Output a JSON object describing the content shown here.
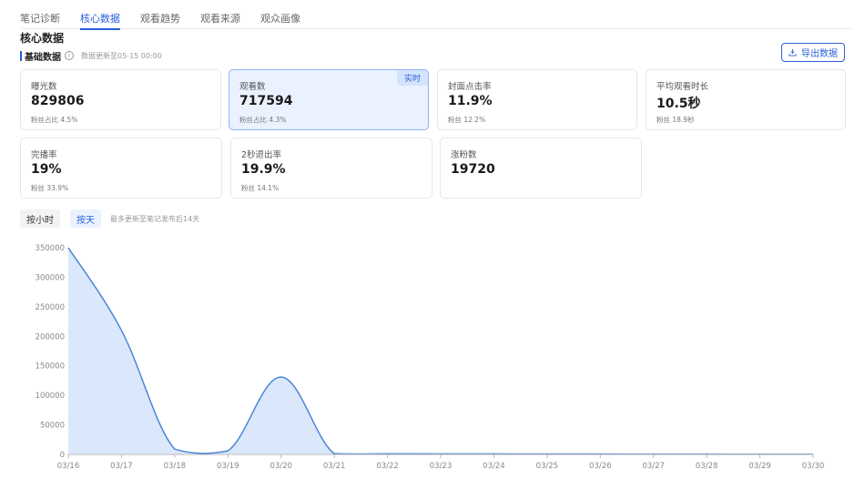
{
  "tabs": [
    {
      "label": "笔记诊断",
      "active": false
    },
    {
      "label": "核心数据",
      "active": true
    },
    {
      "label": "观看趋势",
      "active": false
    },
    {
      "label": "观看来源",
      "active": false
    },
    {
      "label": "观众画像",
      "active": false
    }
  ],
  "section_title": "核心数据",
  "basic": {
    "title": "基础数据",
    "info_icon": "i",
    "updated": "数据更新至05-15 00:00"
  },
  "export_label": "导出数据",
  "cards": [
    {
      "label": "曝光数",
      "value": "829806",
      "sub": "粉丝占比 4.5%",
      "badge": ""
    },
    {
      "label": "观看数",
      "value": "717594",
      "sub": "粉丝占比 4.3%",
      "badge": "实时"
    },
    {
      "label": "封面点击率",
      "value": "11.9%",
      "sub": "粉丝 12.2%",
      "badge": ""
    },
    {
      "label": "平均观看时长",
      "value": "10.5秒",
      "sub": "粉丝 18.9秒",
      "badge": ""
    },
    {
      "label": "完播率",
      "value": "19%",
      "sub": "粉丝 33.9%",
      "badge": ""
    },
    {
      "label": "2秒退出率",
      "value": "19.9%",
      "sub": "粉丝 14.1%",
      "badge": ""
    },
    {
      "label": "涨粉数",
      "value": "19720",
      "sub": "",
      "badge": ""
    }
  ],
  "toggles": {
    "hour": "按小时",
    "day": "按天",
    "selected": "day"
  },
  "toggle_note": "最多更新至笔记发布后14天",
  "colors": {
    "accent": "#2b5fd9",
    "line": "#4a86d6",
    "area": "#dbe8fb"
  },
  "chart_data": {
    "type": "area",
    "x": [
      "03/16",
      "03/17",
      "03/18",
      "03/19",
      "03/20",
      "03/21",
      "03/22",
      "03/23",
      "03/24",
      "03/25",
      "03/26",
      "03/27",
      "03/28",
      "03/29",
      "03/30"
    ],
    "values": [
      350000,
      210000,
      9000,
      6000,
      131000,
      1500,
      1200,
      1000,
      900,
      800,
      700,
      600,
      500,
      400,
      300
    ],
    "yticks": [
      0,
      50000,
      100000,
      150000,
      200000,
      250000,
      300000,
      350000
    ],
    "ylim": [
      0,
      350000
    ],
    "grid": false,
    "smooth": true
  }
}
